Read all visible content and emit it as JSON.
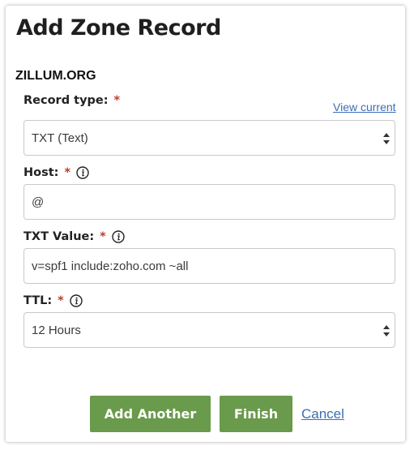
{
  "dialog": {
    "title": "Add Zone Record",
    "domain": "ZILLUM.ORG"
  },
  "fields": {
    "record_type": {
      "label": "Record type:",
      "required": "*",
      "link": "View current",
      "value": "TXT (Text)"
    },
    "host": {
      "label": "Host:",
      "required": "*",
      "value": "@"
    },
    "txt_value": {
      "label": "TXT Value:",
      "required": "*",
      "value": "v=spf1 include:zoho.com ~all"
    },
    "ttl": {
      "label": "TTL:",
      "required": "*",
      "value": "12 Hours"
    }
  },
  "actions": {
    "add_another": "Add Another",
    "finish": "Finish",
    "cancel": "Cancel"
  },
  "colors": {
    "primary_button": "#6a9a4c",
    "link": "#3c6fb5",
    "required_asterisk": "#c0392b"
  },
  "icons": {
    "info": "info-icon",
    "select_arrows": "select-arrows-icon"
  }
}
